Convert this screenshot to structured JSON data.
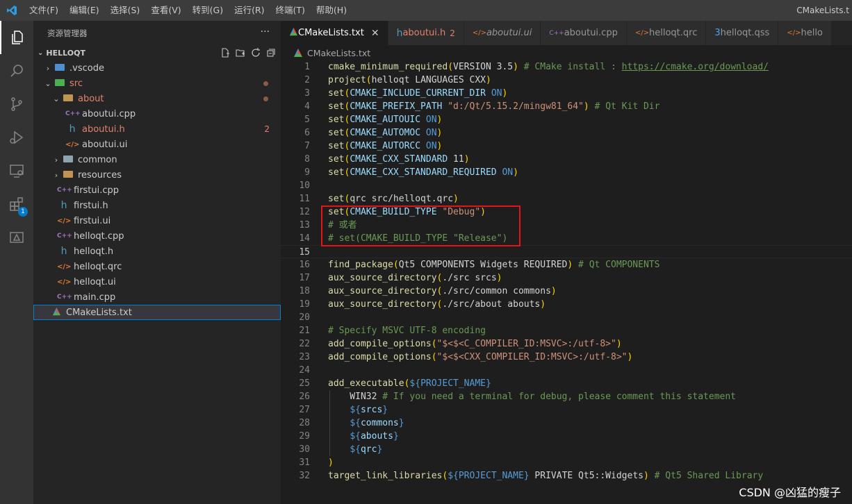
{
  "titlebar": {
    "menu": [
      "文件(F)",
      "编辑(E)",
      "选择(S)",
      "查看(V)",
      "转到(G)",
      "运行(R)",
      "终端(T)",
      "帮助(H)"
    ],
    "window_title": "CMakeLists.t"
  },
  "activity": {
    "icons": [
      "explorer-icon",
      "search-icon",
      "source-control-icon",
      "run-debug-icon",
      "remote-explorer-icon",
      "extensions-icon",
      "cmake-icon"
    ],
    "extensions_badge": "1"
  },
  "sidebar": {
    "title": "资源管理器",
    "more": "···",
    "section": "HELLOQT",
    "items": [
      {
        "label": ".vscode",
        "kind": "folder-vscode",
        "chevron": "›",
        "indent": 0
      },
      {
        "label": "src",
        "kind": "folder-src",
        "chevron": "⌄",
        "indent": 0,
        "modified": true,
        "dot": true
      },
      {
        "label": "about",
        "kind": "folder",
        "chevron": "⌄",
        "indent": 1,
        "modified": true,
        "dot": true
      },
      {
        "label": "aboutui.cpp",
        "kind": "cpp",
        "indent": 2
      },
      {
        "label": "aboutui.h",
        "kind": "h",
        "indent": 2,
        "modified": true,
        "count": "2"
      },
      {
        "label": "aboutui.ui",
        "kind": "xml",
        "indent": 2
      },
      {
        "label": "common",
        "kind": "folder-common",
        "chevron": "›",
        "indent": 1
      },
      {
        "label": "resources",
        "kind": "folder",
        "chevron": "›",
        "indent": 1
      },
      {
        "label": "firstui.cpp",
        "kind": "cpp",
        "indent": 1
      },
      {
        "label": "firstui.h",
        "kind": "h",
        "indent": 1
      },
      {
        "label": "firstui.ui",
        "kind": "xml",
        "indent": 1
      },
      {
        "label": "helloqt.cpp",
        "kind": "cpp",
        "indent": 1
      },
      {
        "label": "helloqt.h",
        "kind": "h",
        "indent": 1
      },
      {
        "label": "helloqt.qrc",
        "kind": "xml",
        "indent": 1
      },
      {
        "label": "helloqt.ui",
        "kind": "xml",
        "indent": 1
      },
      {
        "label": "main.cpp",
        "kind": "cpp",
        "indent": 1
      },
      {
        "label": "CMakeLists.txt",
        "kind": "cmake",
        "indent": 0,
        "selected": true
      }
    ]
  },
  "tabs": [
    {
      "label": "CMakeLists.txt",
      "kind": "cmake",
      "active": true,
      "close": "✕"
    },
    {
      "label": "aboutui.h",
      "kind": "h",
      "modified": true,
      "count": "2"
    },
    {
      "label": "aboutui.ui",
      "kind": "xml",
      "italic": true
    },
    {
      "label": "aboutui.cpp",
      "kind": "cpp"
    },
    {
      "label": "helloqt.qrc",
      "kind": "xml"
    },
    {
      "label": "helloqt.qss",
      "kind": "qss"
    },
    {
      "label": "hello",
      "kind": "xml"
    }
  ],
  "breadcrumb": "CMakeLists.txt",
  "editor": {
    "current_line": 15,
    "lines": [
      [
        [
          "f",
          "cmake_minimum_required"
        ],
        [
          "p",
          "("
        ],
        [
          "d",
          "VERSION 3.5"
        ],
        [
          "p",
          ")"
        ],
        [
          "c",
          " # CMake install : "
        ],
        [
          "cu",
          "https://cmake.org/download/"
        ]
      ],
      [
        [
          "f",
          "project"
        ],
        [
          "p",
          "("
        ],
        [
          "d",
          "helloqt LANGUAGES CXX"
        ],
        [
          "p",
          ")"
        ]
      ],
      [
        [
          "f",
          "set"
        ],
        [
          "p",
          "("
        ],
        [
          "v",
          "CMAKE_INCLUDE_CURRENT_DIR"
        ],
        [
          "d",
          " "
        ],
        [
          "k",
          "ON"
        ],
        [
          "p",
          ")"
        ]
      ],
      [
        [
          "f",
          "set"
        ],
        [
          "p",
          "("
        ],
        [
          "v",
          "CMAKE_PREFIX_PATH"
        ],
        [
          "d",
          " "
        ],
        [
          "s",
          "\"d:/Qt/5.15.2/mingw81_64\""
        ],
        [
          "p",
          ")"
        ],
        [
          "c",
          " # Qt Kit Dir"
        ]
      ],
      [
        [
          "f",
          "set"
        ],
        [
          "p",
          "("
        ],
        [
          "v",
          "CMAKE_AUTOUIC"
        ],
        [
          "d",
          " "
        ],
        [
          "k",
          "ON"
        ],
        [
          "p",
          ")"
        ]
      ],
      [
        [
          "f",
          "set"
        ],
        [
          "p",
          "("
        ],
        [
          "v",
          "CMAKE_AUTOMOC"
        ],
        [
          "d",
          " "
        ],
        [
          "k",
          "ON"
        ],
        [
          "p",
          ")"
        ]
      ],
      [
        [
          "f",
          "set"
        ],
        [
          "p",
          "("
        ],
        [
          "v",
          "CMAKE_AUTORCC"
        ],
        [
          "d",
          " "
        ],
        [
          "k",
          "ON"
        ],
        [
          "p",
          ")"
        ]
      ],
      [
        [
          "f",
          "set"
        ],
        [
          "p",
          "("
        ],
        [
          "v",
          "CMAKE_CXX_STANDARD"
        ],
        [
          "d",
          " 11"
        ],
        [
          "p",
          ")"
        ]
      ],
      [
        [
          "f",
          "set"
        ],
        [
          "p",
          "("
        ],
        [
          "v",
          "CMAKE_CXX_STANDARD_REQUIRED"
        ],
        [
          "d",
          " "
        ],
        [
          "k",
          "ON"
        ],
        [
          "p",
          ")"
        ]
      ],
      [],
      [
        [
          "f",
          "set"
        ],
        [
          "p",
          "("
        ],
        [
          "d",
          "qrc src/helloqt.qrc"
        ],
        [
          "p",
          ")"
        ]
      ],
      [
        [
          "f",
          "set"
        ],
        [
          "p",
          "("
        ],
        [
          "v",
          "CMAKE_BUILD_TYPE"
        ],
        [
          "d",
          " "
        ],
        [
          "s",
          "\"Debug\""
        ],
        [
          "p",
          ")"
        ]
      ],
      [
        [
          "c",
          "# 或者"
        ]
      ],
      [
        [
          "c",
          "# set(CMAKE_BUILD_TYPE \"Release\")"
        ]
      ],
      [],
      [
        [
          "f",
          "find_package"
        ],
        [
          "p",
          "("
        ],
        [
          "d",
          "Qt5 COMPONENTS Widgets REQUIRED"
        ],
        [
          "p",
          ")"
        ],
        [
          "c",
          " # Qt COMPONENTS"
        ]
      ],
      [
        [
          "f",
          "aux_source_directory"
        ],
        [
          "p",
          "("
        ],
        [
          "d",
          "./src srcs"
        ],
        [
          "p",
          ")"
        ]
      ],
      [
        [
          "f",
          "aux_source_directory"
        ],
        [
          "p",
          "("
        ],
        [
          "d",
          "./src/common commons"
        ],
        [
          "p",
          ")"
        ]
      ],
      [
        [
          "f",
          "aux_source_directory"
        ],
        [
          "p",
          "("
        ],
        [
          "d",
          "./src/about abouts"
        ],
        [
          "p",
          ")"
        ]
      ],
      [],
      [
        [
          "c",
          "# Specify MSVC UTF-8 encoding"
        ]
      ],
      [
        [
          "f",
          "add_compile_options"
        ],
        [
          "p",
          "("
        ],
        [
          "s",
          "\"$<$<C_COMPILER_ID:MSVC>:/utf-8>\""
        ],
        [
          "p",
          ")"
        ]
      ],
      [
        [
          "f",
          "add_compile_options"
        ],
        [
          "p",
          "("
        ],
        [
          "s",
          "\"$<$<CXX_COMPILER_ID:MSVC>:/utf-8>\""
        ],
        [
          "p",
          ")"
        ]
      ],
      [],
      [
        [
          "f",
          "add_executable"
        ],
        [
          "p",
          "("
        ],
        [
          "v2",
          "${"
        ],
        [
          "k",
          "PROJECT_NAME"
        ],
        [
          "v2",
          "}"
        ]
      ],
      [
        [
          "d",
          "    WIN32"
        ],
        [
          "c",
          " # If you need a terminal for debug, please comment this statement"
        ]
      ],
      [
        [
          "d",
          "    "
        ],
        [
          "v2",
          "${"
        ],
        [
          "v",
          "srcs"
        ],
        [
          "v2",
          "}"
        ]
      ],
      [
        [
          "d",
          "    "
        ],
        [
          "v2",
          "${"
        ],
        [
          "v",
          "commons"
        ],
        [
          "v2",
          "}"
        ]
      ],
      [
        [
          "d",
          "    "
        ],
        [
          "v2",
          "${"
        ],
        [
          "v",
          "abouts"
        ],
        [
          "v2",
          "}"
        ]
      ],
      [
        [
          "d",
          "    "
        ],
        [
          "v2",
          "${"
        ],
        [
          "v",
          "qrc"
        ],
        [
          "v2",
          "}"
        ]
      ],
      [
        [
          "p",
          ")"
        ]
      ],
      [
        [
          "f",
          "target_link_libraries"
        ],
        [
          "p",
          "("
        ],
        [
          "v2",
          "${"
        ],
        [
          "k",
          "PROJECT_NAME"
        ],
        [
          "v2",
          "}"
        ],
        [
          "d",
          " PRIVATE Qt5::Widgets"
        ],
        [
          "p",
          ")"
        ],
        [
          "c",
          " # Qt5 Shared Library"
        ]
      ]
    ]
  },
  "watermark": "CSDN @凶猛的瘦子",
  "colors": {
    "accent": "#007acc",
    "highlight_box": "#e5141b",
    "modified": "#e2826a"
  }
}
